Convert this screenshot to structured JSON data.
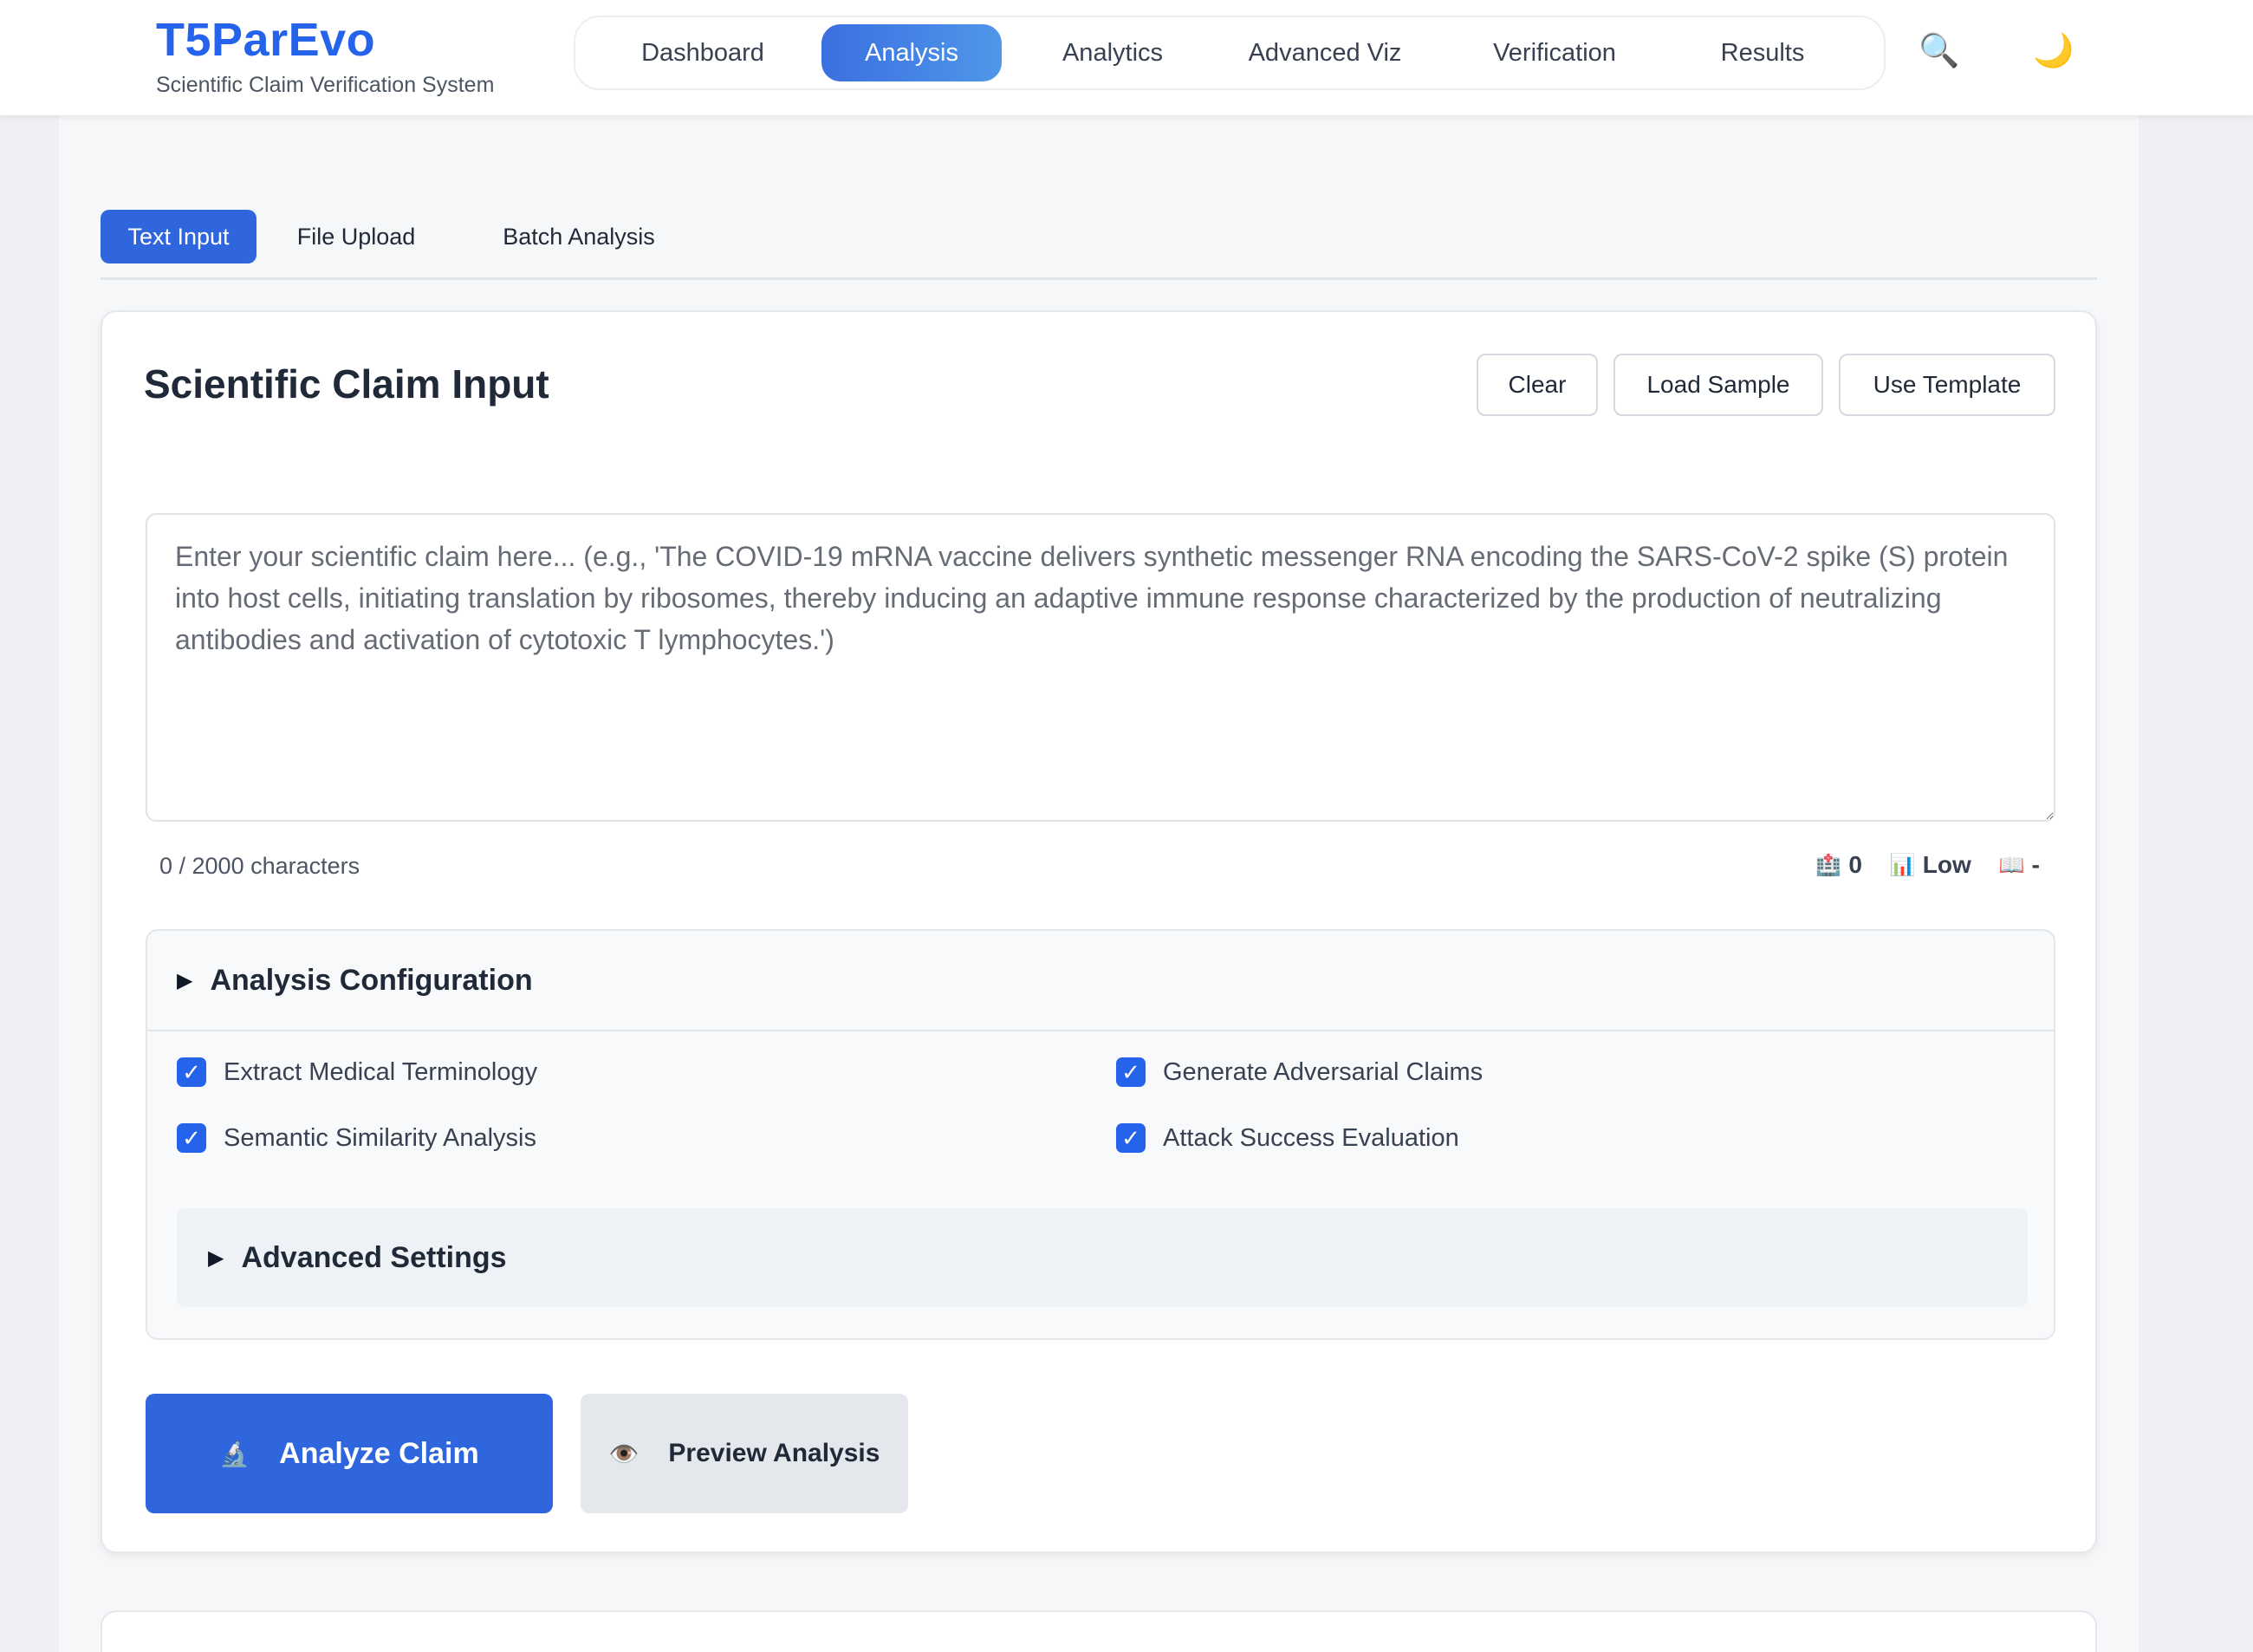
{
  "header": {
    "brand_title": "T5ParEvo",
    "brand_subtitle": "Scientific Claim Verification System",
    "nav": [
      "Dashboard",
      "Analysis",
      "Analytics",
      "Advanced Viz",
      "Verification",
      "Results"
    ],
    "active_nav": "Analysis",
    "search_icon": "🔍",
    "theme_icon": "🌙"
  },
  "tabs": {
    "items": [
      "Text Input",
      "File Upload",
      "Batch Analysis"
    ],
    "active": "Text Input"
  },
  "card": {
    "title": "Scientific Claim Input",
    "actions": {
      "clear": "Clear",
      "load_sample": "Load Sample",
      "use_template": "Use Template"
    },
    "claim_input": {
      "value": "",
      "placeholder": "Enter your scientific claim here... (e.g., 'The COVID-19 mRNA vaccine delivers synthetic messenger RNA encoding the SARS-CoV-2 spike (S) protein into host cells, initiating translation by ribosomes, thereby inducing an adaptive immune response characterized by the production of neutralizing antibodies and activation of cytotoxic T lymphocytes.')"
    },
    "char_count": "0 / 2000 characters",
    "stats": {
      "terms_icon": "🏥",
      "terms_value": "0",
      "complexity_icon": "📊",
      "complexity_value": "Low",
      "readability_icon": "📖",
      "readability_value": "-"
    }
  },
  "config": {
    "title": "Analysis Configuration",
    "options": {
      "extract_terms": "Extract Medical Terminology",
      "adversarial": "Generate Adversarial Claims",
      "similarity": "Semantic Similarity Analysis",
      "attack_eval": "Attack Success Evaluation"
    },
    "checked_mark": "✓",
    "advanced_title": "Advanced Settings"
  },
  "buttons": {
    "analyze_icon": "🔬",
    "analyze": "Analyze Claim",
    "preview_icon": "👁️",
    "preview": "Preview Analysis"
  },
  "colors": {
    "primary": "#2f66dd",
    "brand": "#2563eb"
  }
}
